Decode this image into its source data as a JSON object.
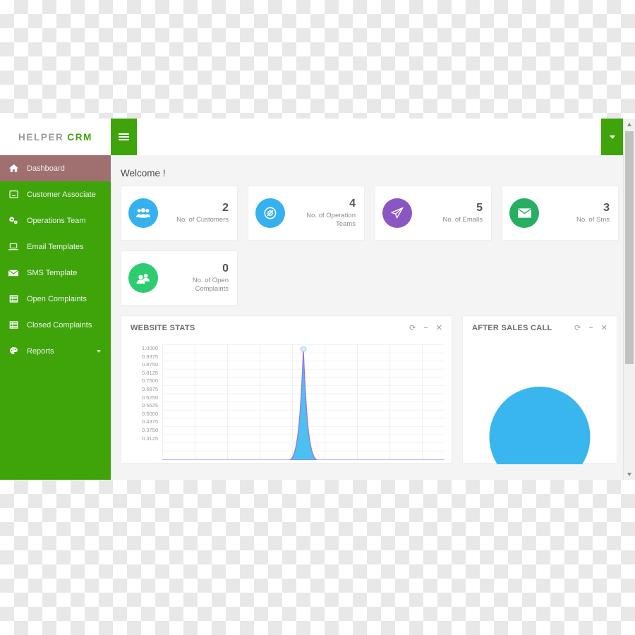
{
  "brand": {
    "primary": "HELPER",
    "accent": "CRM",
    "accent_color": "#3fa40a"
  },
  "topbar": {
    "menu_toggle_name": "hamburger-menu",
    "profile_caret_name": "profile-dropdown-caret"
  },
  "sidebar": {
    "background": "#3fa40a",
    "active_background": "#a06f6f",
    "items": [
      {
        "label": "Dashboard",
        "icon": "home-icon",
        "active": true,
        "has_caret": false
      },
      {
        "label": "Customer Associate",
        "icon": "inbox-icon",
        "active": false,
        "has_caret": false
      },
      {
        "label": "Operations Team",
        "icon": "cogs-icon",
        "active": false,
        "has_caret": false
      },
      {
        "label": "Email Templates",
        "icon": "laptop-icon",
        "active": false,
        "has_caret": false
      },
      {
        "label": "SMS Template",
        "icon": "envelope-icon",
        "active": false,
        "has_caret": false
      },
      {
        "label": "Open Complaints",
        "icon": "list-icon",
        "active": false,
        "has_caret": false
      },
      {
        "label": "Closed Complaints",
        "icon": "list-icon",
        "active": false,
        "has_caret": false
      },
      {
        "label": "Reports",
        "icon": "palette-icon",
        "active": false,
        "has_caret": true
      }
    ]
  },
  "main": {
    "welcome": "Welcome !",
    "stat_cards": [
      {
        "value": "2",
        "label": "No. of Customers",
        "icon": "users-icon",
        "color": "#35b1ef"
      },
      {
        "value": "4",
        "label": "No. of Operation Teams",
        "icon": "compass-icon",
        "color": "#35b1ef"
      },
      {
        "value": "5",
        "label": "No. of Emails",
        "icon": "paper-plane-icon",
        "color": "#8a56c2"
      },
      {
        "value": "3",
        "label": "No. of Sms",
        "icon": "envelope-icon",
        "color": "#27ae60"
      },
      {
        "value": "0",
        "label": "No. of Open Complaints",
        "icon": "user-group-icon",
        "color": "#2ecc71"
      }
    ],
    "panels": [
      {
        "title": "WEBSITE STATS",
        "tools": [
          {
            "name": "refresh-icon",
            "glyph": "⟳"
          },
          {
            "name": "minimize-icon",
            "glyph": "−"
          },
          {
            "name": "close-icon",
            "glyph": "✕"
          }
        ]
      },
      {
        "title": "AFTER SALES CALL",
        "tools": [
          {
            "name": "refresh-icon",
            "glyph": "⟳"
          },
          {
            "name": "minimize-icon",
            "glyph": "−"
          },
          {
            "name": "close-icon",
            "glyph": "✕"
          }
        ]
      }
    ]
  },
  "chart_data": [
    {
      "type": "area",
      "title": "WEBSITE STATS",
      "xlabel": "",
      "ylabel": "",
      "ylim": [
        0,
        1
      ],
      "grid": true,
      "legend": "none",
      "fill_color": "#4cc0f0",
      "line_color": "#a26be0",
      "marker_color": "#d6ecf8",
      "ytick_labels": [
        "1.0000",
        "0.9375",
        "0.8750",
        "0.8125",
        "0.7500",
        "0.6875",
        "0.6250",
        "0.5625",
        "0.5000",
        "0.4375",
        "0.3750",
        "0.3125"
      ],
      "ytick_values": [
        1.0,
        0.9375,
        0.875,
        0.8125,
        0.75,
        0.6875,
        0.625,
        0.5625,
        0.5,
        0.4375,
        0.375,
        0.3125
      ],
      "x": [
        0,
        1,
        2,
        3,
        4,
        5,
        6,
        7,
        8
      ],
      "values": [
        0,
        0,
        0,
        0,
        1.0,
        0,
        0,
        0,
        0
      ],
      "note": "single sharp spike to 1.0000 at the 5th category; all other points 0"
    },
    {
      "type": "pie",
      "title": "AFTER SALES CALL",
      "legend": "none",
      "labels": [
        "After Sales Call"
      ],
      "values": [
        100
      ],
      "colors": [
        "#3ab6ef"
      ]
    }
  ],
  "scrollbar": {
    "up_name": "scroll-up-arrow",
    "down_name": "scroll-down-arrow",
    "thumb_name": "scroll-thumb"
  }
}
